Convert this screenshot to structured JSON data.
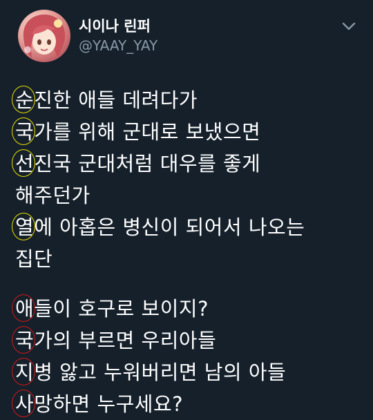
{
  "profile": {
    "display_name": "시이나 린퍼",
    "handle": "@YAAY_YAY"
  },
  "tweet": {
    "paragraph1": [
      {
        "first": "순",
        "rest": "진한 애들 데려다가",
        "circle": "yellow"
      },
      {
        "first": "국",
        "rest": "가를 위해 군대로 보냈으면",
        "circle": "yellow"
      },
      {
        "first": "선",
        "rest": "진국 군대처럼 대우를 좋게",
        "circle": "yellow"
      },
      {
        "first": "",
        "rest": "해주던가",
        "circle": ""
      },
      {
        "first": "열",
        "rest": "에 아홉은 병신이 되어서 나오는",
        "circle": "yellow"
      },
      {
        "first": "",
        "rest": "집단",
        "circle": ""
      }
    ],
    "paragraph2": [
      {
        "first": "애",
        "rest": "들이 호구로 보이지?",
        "circle": "red"
      },
      {
        "first": "국",
        "rest": "가의 부르면 우리아들",
        "circle": "red"
      },
      {
        "first": "지",
        "rest": "병 앓고 누워버리면 남의 아들",
        "circle": "red"
      },
      {
        "first": "사",
        "rest": "망하면 누구세요?",
        "circle": "red"
      }
    ]
  },
  "colors": {
    "background": "#15202b",
    "handle": "#8899a6",
    "highlight_yellow": "#e6e000",
    "highlight_red": "#d01818"
  },
  "icons": {
    "menu": "chevron-down-icon",
    "avatar": "anime-girl-avatar"
  }
}
